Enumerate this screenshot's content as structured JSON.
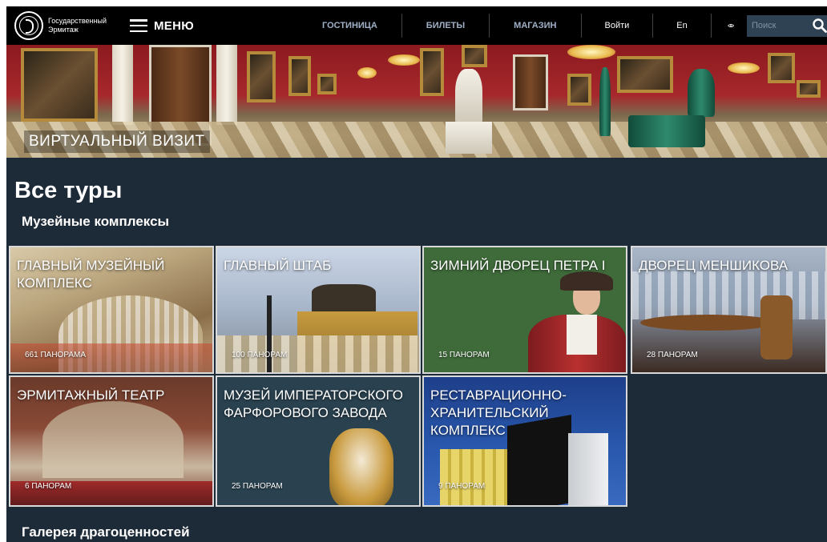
{
  "header": {
    "logo_text": "Государственный Эрмитаж",
    "menu_label": "МЕНЮ",
    "nav": [
      "ГОСТИНИЦА",
      "БИЛЕТЫ",
      "МАГАЗИН"
    ],
    "login": "Войти",
    "lang": "En",
    "search_placeholder": "Поиск",
    "accent": "#9fb0c7"
  },
  "hero": {
    "label": "ВИРТУАЛЬНЫЙ ВИЗИТ"
  },
  "main": {
    "title": "Все туры",
    "section1": "Музейные комплексы",
    "section2": "Галерея драгоценностей",
    "background": "#1d2a38",
    "cards": [
      {
        "title": "ГЛАВНЫЙ МУЗЕЙНЫЙ КОМПЛЕКС",
        "count": "661 ПАНОРАМА"
      },
      {
        "title": "ГЛАВНЫЙ ШТАБ",
        "count": "100 ПАНОРАМ"
      },
      {
        "title": "ЗИМНИЙ ДВОРЕЦ ПЕТРА I",
        "count": "15 ПАНОРАМ"
      },
      {
        "title": "ДВОРЕЦ МЕНШИКОВА",
        "count": "28 ПАНОРАМ"
      },
      {
        "title": "ЭРМИТАЖНЫЙ ТЕАТР",
        "count": "6 ПАНОРАМ"
      },
      {
        "title": "МУЗЕЙ ИМПЕРАТОРСКОГО ФАРФОРОВОГО ЗАВОДА",
        "count": "25 ПАНОРАМ"
      },
      {
        "title": "РЕСТАВРАЦИОННО-ХРАНИТЕЛЬСКИЙ КОМПЛЕКС",
        "count": "9 ПАНОРАМ"
      }
    ]
  }
}
